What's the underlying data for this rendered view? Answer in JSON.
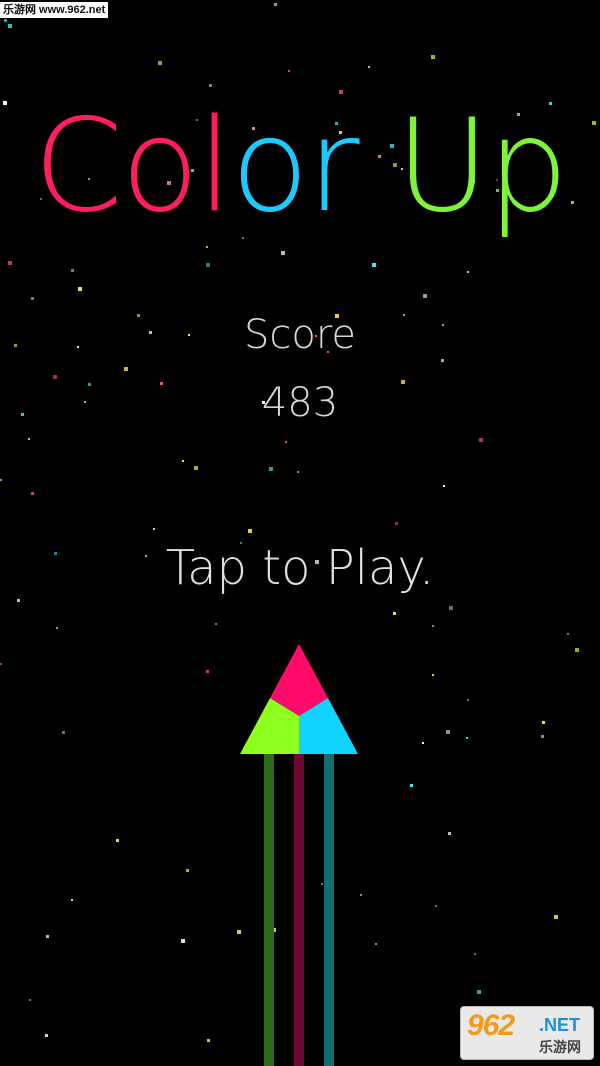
{
  "watermark_top": "乐游网 www.962.net",
  "title": {
    "letters": [
      {
        "char": "C",
        "color": "#ff1f5e"
      },
      {
        "char": "o",
        "color": "#ff1f5e"
      },
      {
        "char": "l",
        "color": "#ff1f5e"
      },
      {
        "char": "o",
        "color": "#1ec9ff"
      },
      {
        "char": "r",
        "color": "#1ec9ff"
      },
      {
        "char": " ",
        "color": "#000000"
      },
      {
        "char": "U",
        "color": "#7df43a"
      },
      {
        "char": "p",
        "color": "#7df43a"
      }
    ]
  },
  "score": {
    "label": "Score",
    "value": "483"
  },
  "prompt": "Tap to Play.",
  "ship": {
    "colors": {
      "pink": "#ff0c6b",
      "green": "#8cff1e",
      "cyan": "#12d2ff"
    },
    "trail_colors": [
      "#2f6a17",
      "#6d0630",
      "#0f6f72"
    ]
  },
  "watermark_bottom": {
    "number": "962",
    "net": ".NET",
    "sub": "乐游网"
  },
  "star_colors": [
    "#ff4fa1",
    "#44e8ff",
    "#b3ff3c",
    "#ffffff",
    "#ffe55a",
    "#ff9ccf"
  ]
}
